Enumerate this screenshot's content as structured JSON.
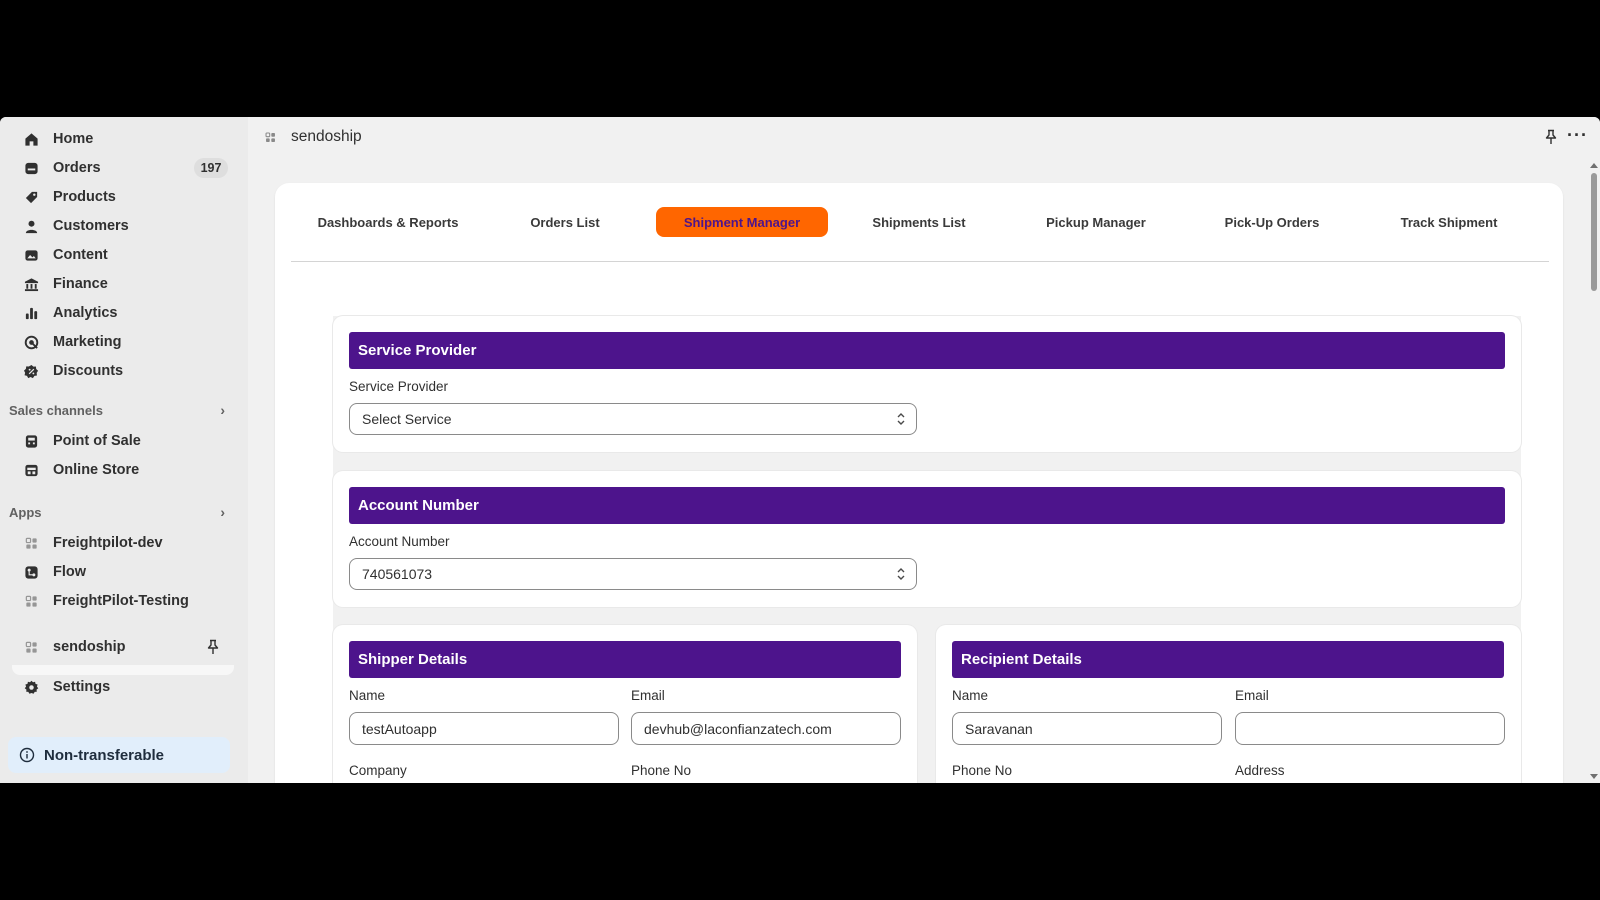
{
  "sidebar": {
    "nav": [
      {
        "label": "Home",
        "icon": "home-icon"
      },
      {
        "label": "Orders",
        "icon": "orders-icon",
        "badge": "197"
      },
      {
        "label": "Products",
        "icon": "tag-icon"
      },
      {
        "label": "Customers",
        "icon": "person-icon"
      },
      {
        "label": "Content",
        "icon": "image-icon"
      },
      {
        "label": "Finance",
        "icon": "bank-icon"
      },
      {
        "label": "Analytics",
        "icon": "bar-chart-icon"
      },
      {
        "label": "Marketing",
        "icon": "target-icon"
      },
      {
        "label": "Discounts",
        "icon": "discount-icon"
      }
    ],
    "sales_channels": {
      "heading": "Sales channels",
      "items": [
        {
          "label": "Point of Sale",
          "icon": "pos-icon"
        },
        {
          "label": "Online Store",
          "icon": "store-icon"
        }
      ]
    },
    "apps": {
      "heading": "Apps",
      "items": [
        {
          "label": "Freightpilot-dev",
          "icon": "app-grid-icon"
        },
        {
          "label": "Flow",
          "icon": "flow-icon"
        },
        {
          "label": "FreightPilot-Testing",
          "icon": "app-grid-icon"
        }
      ]
    },
    "pinned_app": {
      "label": "sendoship",
      "icon": "app-grid-icon"
    },
    "settings": {
      "label": "Settings",
      "icon": "gear-icon"
    },
    "notice": {
      "label": "Non-transferable",
      "icon": "info-icon"
    }
  },
  "header": {
    "app_title": "sendoship"
  },
  "tabs": [
    {
      "label": "Dashboards & Reports",
      "active": false
    },
    {
      "label": "Orders List",
      "active": false
    },
    {
      "label": "Shipment Manager",
      "active": true
    },
    {
      "label": "Shipments List",
      "active": false
    },
    {
      "label": "Pickup Manager",
      "active": false
    },
    {
      "label": "Pick-Up Orders",
      "active": false
    },
    {
      "label": "Track Shipment",
      "active": false
    }
  ],
  "service_provider": {
    "heading": "Service Provider",
    "label": "Service Provider",
    "value": "Select Service"
  },
  "account_number": {
    "heading": "Account Number",
    "label": "Account Number",
    "value": "740561073"
  },
  "shipper": {
    "heading": "Shipper Details",
    "name_label": "Name",
    "name_value": "testAutoapp",
    "email_label": "Email",
    "email_value": "devhub@laconfianzatech.com",
    "company_label": "Company",
    "phone_label": "Phone No"
  },
  "recipient": {
    "heading": "Recipient Details",
    "name_label": "Name",
    "name_value": "Saravanan",
    "email_label": "Email",
    "email_value": "",
    "phone_label": "Phone No",
    "address_label": "Address"
  },
  "colors": {
    "accent_orange": "#ff6600",
    "header_purple": "#4d148c",
    "notice_bg": "#e1eefb"
  }
}
